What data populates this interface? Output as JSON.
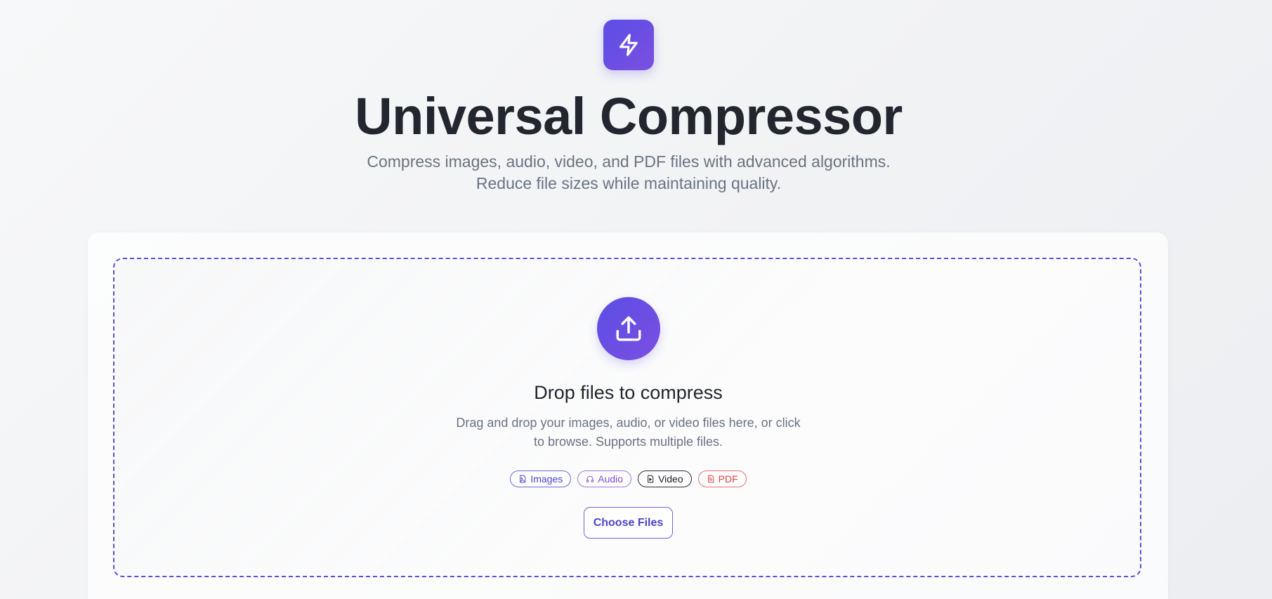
{
  "app": {
    "logo_icon": "lightning-bolt-icon",
    "title": "Universal Compressor",
    "subtitle_line1": "Compress images, audio, video, and PDF files with advanced algorithms.",
    "subtitle_line2": "Reduce file sizes while maintaining quality."
  },
  "dropzone": {
    "icon": "upload-icon",
    "title": "Drop files to compress",
    "desc_line1": "Drag and drop your images, audio, or video files here, or click",
    "desc_line2": "to browse. Supports multiple files.",
    "chips": [
      {
        "label": "Images",
        "icon": "image-file-icon",
        "color": "#4b48c9"
      },
      {
        "label": "Audio",
        "icon": "audio-file-icon",
        "color": "#8a4cd0"
      },
      {
        "label": "Video",
        "icon": "video-file-icon",
        "color": "#1d1f27"
      },
      {
        "label": "PDF",
        "icon": "pdf-file-icon",
        "color": "#d84545"
      }
    ],
    "choose_button": "Choose Files"
  },
  "colors": {
    "accent": "#5b4ee6",
    "accent_secondary": "#7b4fe0",
    "text_primary": "#23252f",
    "text_muted": "#6b7282"
  }
}
